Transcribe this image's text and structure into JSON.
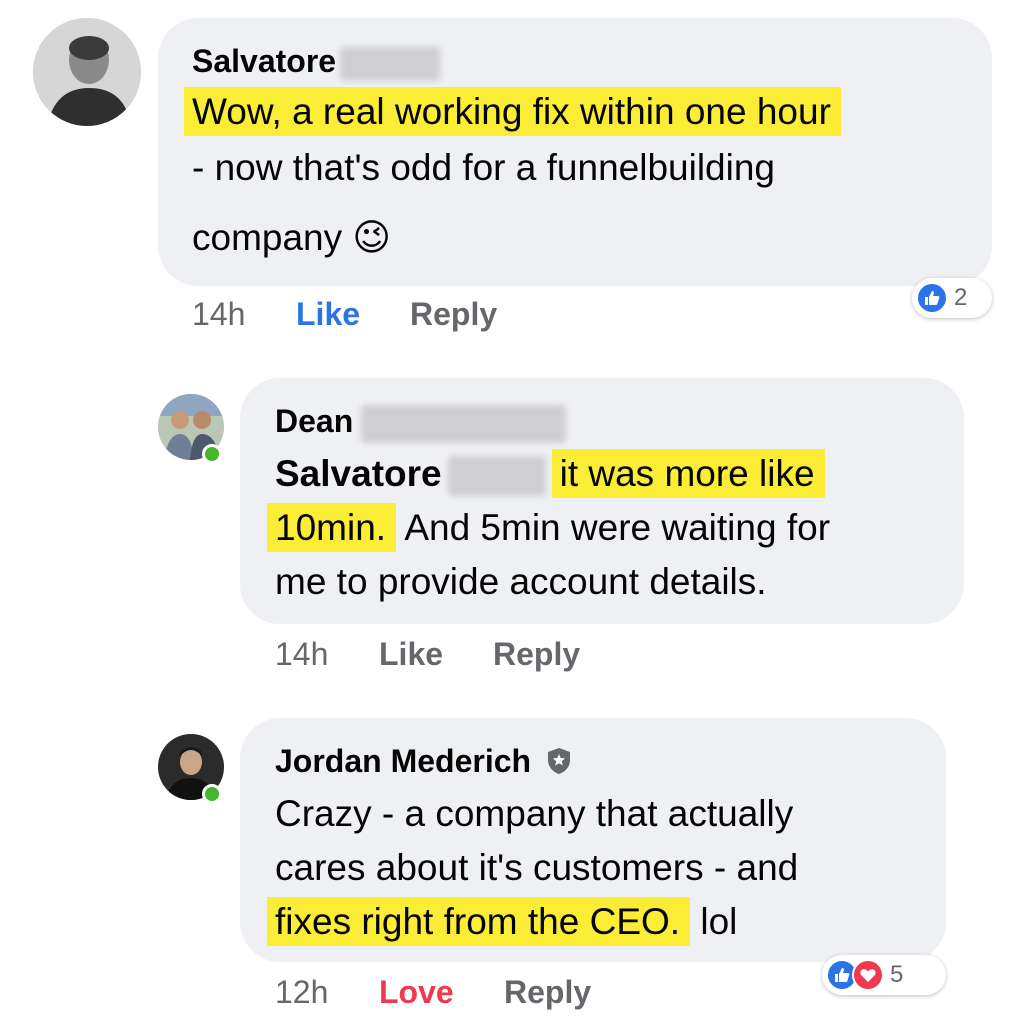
{
  "comments": [
    {
      "author": "Salvatore",
      "lines": [
        "Wow, a real working fix within one hour",
        "- now that's odd for a funnelbuilding",
        "company"
      ],
      "emoji": "😉",
      "time": "14h",
      "like_label": "Like",
      "reply_label": "Reply",
      "reaction_count": "2",
      "reactions": [
        "like-icon"
      ]
    },
    {
      "author": "Dean",
      "mention": "Salvatore",
      "lines": [
        "it was more like",
        "10min.",
        "And 5min were waiting for",
        "me to provide account details."
      ],
      "time": "14h",
      "like_label": "Like",
      "reply_label": "Reply"
    },
    {
      "author": "Jordan Mederich",
      "badge": "shield-icon",
      "lines": [
        "Crazy - a company that actually",
        "cares about it's customers - and",
        "fixes right from the CEO.",
        "lol"
      ],
      "time": "12h",
      "like_label": "Love",
      "reply_label": "Reply",
      "reaction_count": "5",
      "reactions": [
        "like-icon",
        "love-icon"
      ]
    }
  ],
  "colors": {
    "highlight": "#fbec36",
    "bubble": "#eff0f3",
    "like_blue": "#2a73e8",
    "love_red": "#f0384f",
    "online_green": "#42b72a"
  }
}
